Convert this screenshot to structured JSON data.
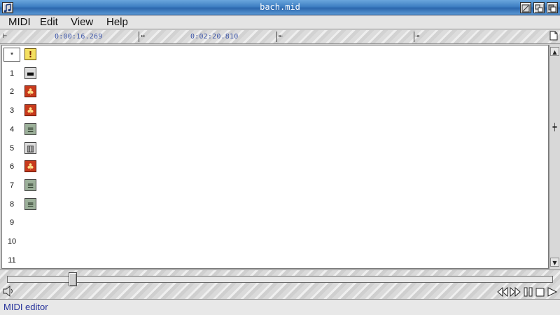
{
  "window": {
    "title": "bach.mid",
    "menu_icon": "note-icon"
  },
  "menu": {
    "items": [
      "MIDI",
      "Edit",
      "View",
      "Help"
    ]
  },
  "ruler": {
    "times": [
      "0:00:16.269",
      "0:02:20.810"
    ]
  },
  "tracks": [
    {
      "label": "*",
      "icon": "metronome-icon"
    },
    {
      "label": "1",
      "icon": "piano-icon"
    },
    {
      "label": "2",
      "icon": "guitar-icon"
    },
    {
      "label": "3",
      "icon": "guitar-icon"
    },
    {
      "label": "4",
      "icon": "flute-icon"
    },
    {
      "label": "5",
      "icon": "keyboard-icon"
    },
    {
      "label": "6",
      "icon": "guitar-icon"
    },
    {
      "label": "7",
      "icon": "flute-icon"
    },
    {
      "label": "8",
      "icon": "flute-icon"
    },
    {
      "label": "9",
      "icon": ""
    },
    {
      "label": "10",
      "icon": ""
    },
    {
      "label": "11",
      "icon": ""
    }
  ],
  "scroll": {
    "horizontal_position": 0.12
  },
  "status": {
    "text": "MIDI editor"
  }
}
